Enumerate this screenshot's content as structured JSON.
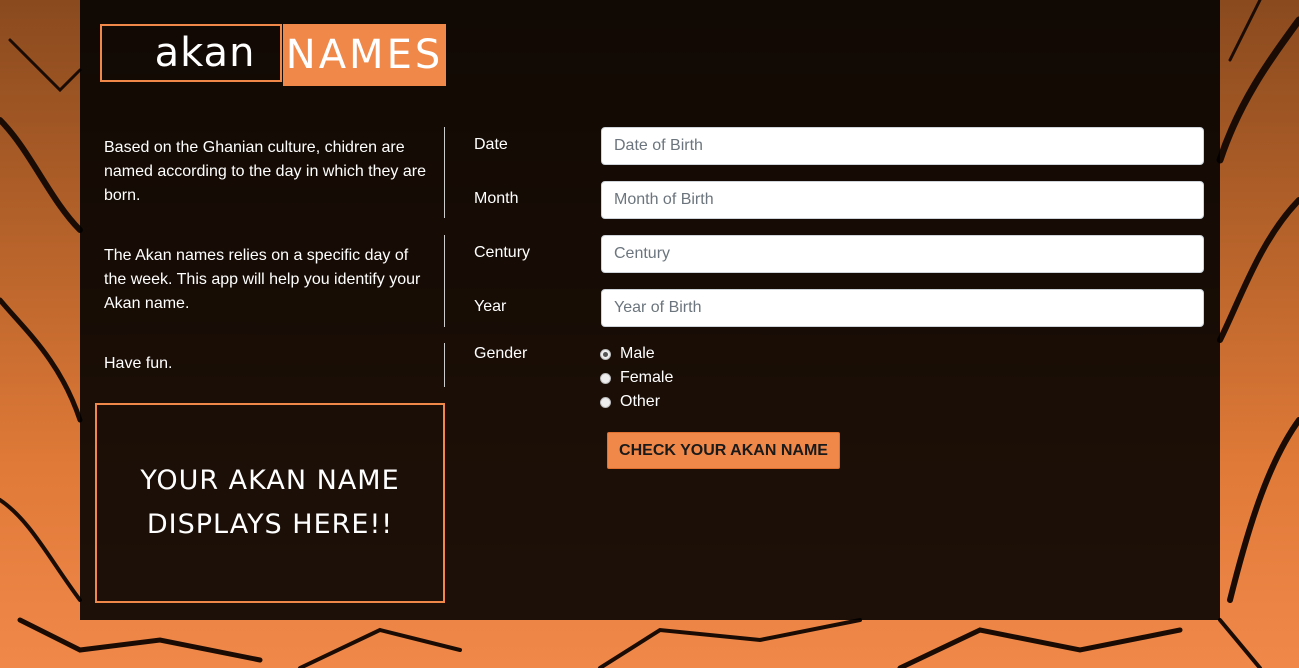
{
  "logo": {
    "part1": "akan",
    "part2": "NAMES"
  },
  "info": {
    "p1": "Based on the Ghanian culture, chidren are named according to the day in which they are born.",
    "p2": "The Akan names relies on a specific day of the week. This app will help you identify your Akan name.",
    "p3": "Have fun."
  },
  "result": {
    "line1": "YOUR AKAN NAME",
    "line2": "DISPLAYS HERE!!"
  },
  "form": {
    "date": {
      "label": "Date",
      "placeholder": "Date of Birth"
    },
    "month": {
      "label": "Month",
      "placeholder": "Month of Birth"
    },
    "century": {
      "label": "Century",
      "placeholder": "Century"
    },
    "year": {
      "label": "Year",
      "placeholder": "Year of Birth"
    },
    "gender": {
      "label": "Gender",
      "options": [
        "Male",
        "Female",
        "Other"
      ],
      "selected": "Male"
    },
    "submit_label": "CHECK YOUR AKAN NAME"
  },
  "colors": {
    "accent": "#f0884a",
    "panel": "#000000"
  }
}
